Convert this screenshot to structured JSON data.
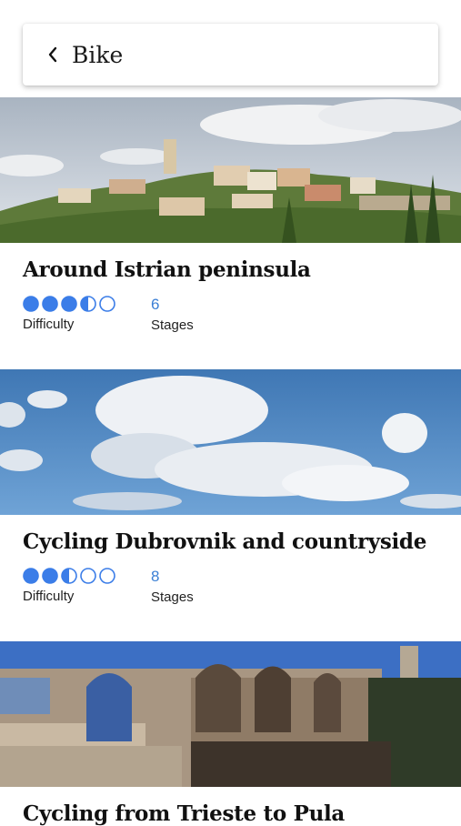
{
  "header": {
    "title": "Bike",
    "back_icon": "chevron-left-icon"
  },
  "colors": {
    "accent": "#3a7fd5",
    "dot": "#3b7de8"
  },
  "tours": [
    {
      "title": "Around Istrian peninsula",
      "difficulty": 3.5,
      "difficulty_max": 5,
      "difficulty_label": "Difficulty",
      "stages": "6",
      "stages_label": "Stages",
      "image": "hilltop-village-photo"
    },
    {
      "title": "Cycling Dubrovnik and countryside",
      "difficulty": 2.5,
      "difficulty_max": 5,
      "difficulty_label": "Difficulty",
      "stages": "8",
      "stages_label": "Stages",
      "image": "cloudy-sky-photo"
    },
    {
      "title": "Cycling from Trieste to Pula",
      "image": "amphitheatre-ruins-photo"
    }
  ]
}
